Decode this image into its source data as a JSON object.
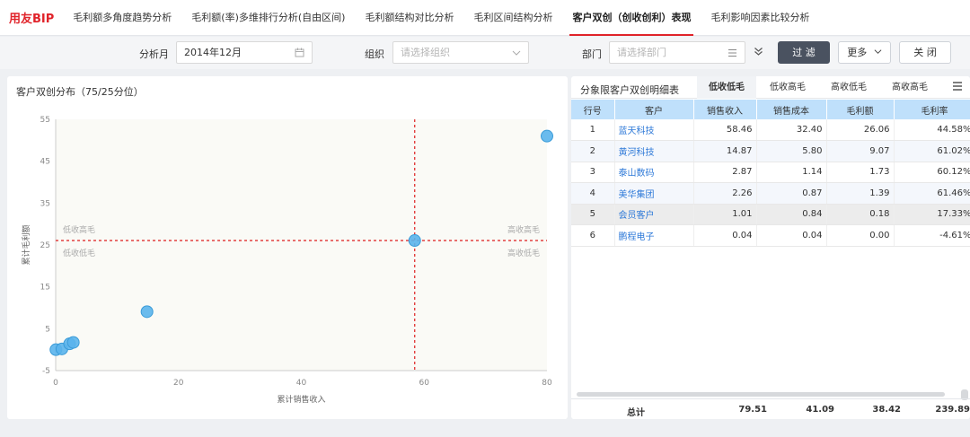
{
  "app": {
    "logo": "用友BIP"
  },
  "tabs": [
    {
      "label": "毛利额多角度趋势分析"
    },
    {
      "label": "毛利额(率)多维排行分析(自由区间)"
    },
    {
      "label": "毛利额结构对比分析"
    },
    {
      "label": "毛利区间结构分析"
    },
    {
      "label": "客户双创（创收创利）表现"
    },
    {
      "label": "毛利影响因素比较分析"
    }
  ],
  "filters": {
    "month_label": "分析月",
    "month_value": "2014年12月",
    "org_label": "组织",
    "org_placeholder": "请选择组织",
    "dept_label": "部门",
    "dept_placeholder": "请选择部门",
    "filter_btn": "过 滤",
    "more_btn": "更多",
    "close_btn": "关 闭"
  },
  "left_panel": {
    "title": "客户双创分布（75/25分位）"
  },
  "chart_data": {
    "type": "scatter",
    "title": "客户双创分布（75/25分位）",
    "xlabel": "累计销售收入",
    "ylabel": "累计毛利额",
    "xlim": [
      0,
      80
    ],
    "ylim": [
      -5,
      55
    ],
    "xticks": [
      0,
      20,
      40,
      60,
      80
    ],
    "yticks": [
      -5,
      5,
      15,
      25,
      35,
      45,
      55
    ],
    "x_threshold": 58.46,
    "y_threshold": 26.06,
    "quadrant_labels": {
      "top_left": "低收高毛",
      "bottom_left": "低收低毛",
      "top_right": "高收高毛",
      "bottom_right": "高收低毛"
    },
    "points": [
      {
        "x": 0.04,
        "y": 0
      },
      {
        "x": 1.01,
        "y": 0.18
      },
      {
        "x": 2.26,
        "y": 1.39
      },
      {
        "x": 2.87,
        "y": 1.73
      },
      {
        "x": 14.87,
        "y": 9.07
      },
      {
        "x": 58.46,
        "y": 26.06
      },
      {
        "x": 80,
        "y": 51
      }
    ],
    "color": "#5ab4ec",
    "grid": false
  },
  "right_panel": {
    "title": "分象限客户双创明细表",
    "tabs": [
      {
        "label": "低收低毛"
      },
      {
        "label": "低收高毛"
      },
      {
        "label": "高收低毛"
      },
      {
        "label": "高收高毛"
      }
    ],
    "columns": [
      "行号",
      "客户",
      "销售收入",
      "销售成本",
      "毛利额",
      "毛利率"
    ],
    "rows": [
      [
        "1",
        "蓝天科技",
        "58.46",
        "32.40",
        "26.06",
        "44.58%"
      ],
      [
        "2",
        "黄河科技",
        "14.87",
        "5.80",
        "9.07",
        "61.02%"
      ],
      [
        "3",
        "泰山数码",
        "2.87",
        "1.14",
        "1.73",
        "60.12%"
      ],
      [
        "4",
        "美华集团",
        "2.26",
        "0.87",
        "1.39",
        "61.46%"
      ],
      [
        "5",
        "会员客户",
        "1.01",
        "0.84",
        "0.18",
        "17.33%"
      ],
      [
        "6",
        "鹏程电子",
        "0.04",
        "0.04",
        "0.00",
        "-4.61%"
      ]
    ],
    "totals": {
      "label": "总计",
      "revenue": "79.51",
      "cost": "41.09",
      "profit": "38.42",
      "rate": "239.89%"
    }
  }
}
